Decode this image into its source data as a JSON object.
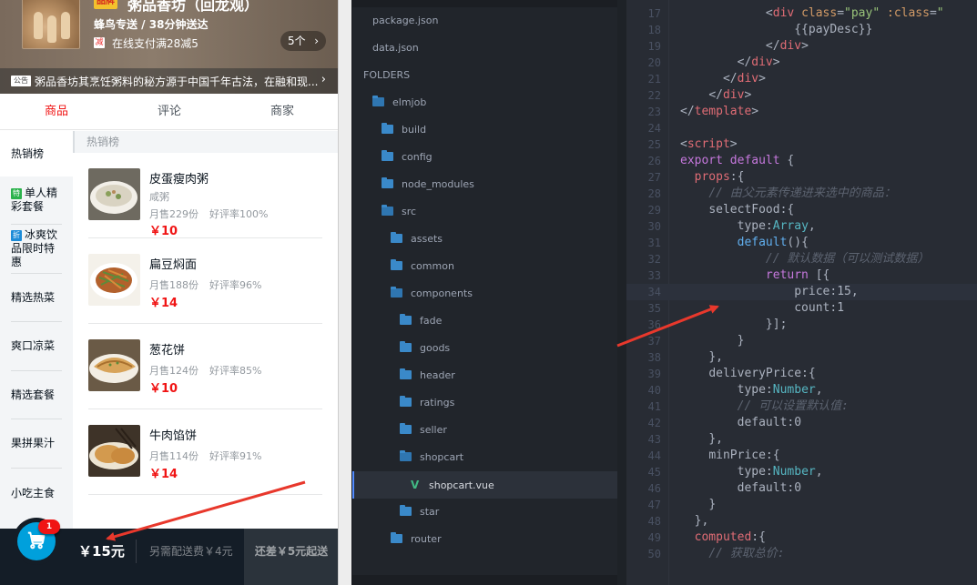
{
  "app": {
    "brand_badge": "品牌",
    "shop_name": "粥品香坊（回龙观）",
    "delivery": "蜂鸟专送 / 38分钟送达",
    "discount_icon": "减",
    "discount_text": "在线支付满28减5",
    "discount_count": "5个",
    "bulletin_badge": "公告",
    "bulletin_text": "粥品香坊其烹饪粥料的秘方源于中国千年古法，在融和现...",
    "tabs": [
      "商品",
      "评论",
      "商家"
    ],
    "menu": [
      {
        "label": "热销榜",
        "tag": ""
      },
      {
        "label": "单人精彩套餐",
        "tag": "特"
      },
      {
        "label": "冰爽饮品限时特惠",
        "tag": "折"
      },
      {
        "label": "精选热菜",
        "tag": ""
      },
      {
        "label": "爽口凉菜",
        "tag": ""
      },
      {
        "label": "精选套餐",
        "tag": ""
      },
      {
        "label": "果拼果汁",
        "tag": ""
      },
      {
        "label": "小吃主食",
        "tag": ""
      }
    ],
    "category_title": "热销榜",
    "foods": [
      {
        "name": "皮蛋瘦肉粥",
        "desc": "咸粥",
        "sell": "月售229份",
        "rating": "好评率100%",
        "price": "￥10"
      },
      {
        "name": "扁豆焖面",
        "desc": "",
        "sell": "月售188份",
        "rating": "好评率96%",
        "price": "￥14"
      },
      {
        "name": "葱花饼",
        "desc": "",
        "sell": "月售124份",
        "rating": "好评率85%",
        "price": "￥10"
      },
      {
        "name": "牛肉馅饼",
        "desc": "",
        "sell": "月售114份",
        "rating": "好评率91%",
        "price": "￥14"
      }
    ],
    "cart": {
      "badge": "1",
      "total": "￥15元",
      "fee": "另需配送费￥4元",
      "pay": "还差￥5元起送"
    }
  },
  "tree": {
    "rows": [
      {
        "label": "package.json",
        "icon": "none",
        "indent": 0
      },
      {
        "label": "data.json",
        "icon": "none",
        "indent": 0
      },
      {
        "label": "FOLDERS",
        "icon": "none",
        "indent": -1
      },
      {
        "label": "elmjob",
        "icon": "folder-open",
        "indent": 1
      },
      {
        "label": "build",
        "icon": "folder",
        "indent": 2
      },
      {
        "label": "config",
        "icon": "folder",
        "indent": 2
      },
      {
        "label": "node_modules",
        "icon": "folder",
        "indent": 2
      },
      {
        "label": "src",
        "icon": "folder-open",
        "indent": 2
      },
      {
        "label": "assets",
        "icon": "folder",
        "indent": 3
      },
      {
        "label": "common",
        "icon": "folder",
        "indent": 3
      },
      {
        "label": "components",
        "icon": "folder-open",
        "indent": 3
      },
      {
        "label": "fade",
        "icon": "folder",
        "indent": 4
      },
      {
        "label": "goods",
        "icon": "folder",
        "indent": 4
      },
      {
        "label": "header",
        "icon": "folder",
        "indent": 4
      },
      {
        "label": "ratings",
        "icon": "folder",
        "indent": 4
      },
      {
        "label": "seller",
        "icon": "folder",
        "indent": 4
      },
      {
        "label": "shopcart",
        "icon": "folder-open",
        "indent": 4
      },
      {
        "label": "shopcart.vue",
        "icon": "vue",
        "indent": 5
      },
      {
        "label": "star",
        "icon": "folder",
        "indent": 4
      },
      {
        "label": "router",
        "icon": "folder",
        "indent": 3
      }
    ]
  },
  "editor": {
    "lines": [
      {
        "n": "17",
        "html": "            <span class='p'>&lt;</span><span class='t'>div</span> <span class='a'>class</span><span class='p'>=</span><span class='s'>\"pay\"</span> <span class='a'>:class</span><span class='p'>=</span><span class='s'>\"</span>"
      },
      {
        "n": "18",
        "html": "                <span class='p'>{{payDesc}}</span>"
      },
      {
        "n": "19",
        "html": "            <span class='p'>&lt;/</span><span class='t'>div</span><span class='p'>&gt;</span>"
      },
      {
        "n": "20",
        "html": "        <span class='p'>&lt;/</span><span class='t'>div</span><span class='p'>&gt;</span>"
      },
      {
        "n": "21",
        "html": "      <span class='p'>&lt;/</span><span class='t'>div</span><span class='p'>&gt;</span>"
      },
      {
        "n": "22",
        "html": "    <span class='p'>&lt;/</span><span class='t'>div</span><span class='p'>&gt;</span>"
      },
      {
        "n": "23",
        "html": "<span class='p'>&lt;/</span><span class='t'>template</span><span class='p'>&gt;</span>"
      },
      {
        "n": "24",
        "html": ""
      },
      {
        "n": "25",
        "html": "<span class='p'>&lt;</span><span class='t'>script</span><span class='p'>&gt;</span>"
      },
      {
        "n": "26",
        "html": "<span class='k'>export</span> <span class='k'>default</span> <span class='p'>{</span>"
      },
      {
        "n": "27",
        "html": "  <span class='t'>props</span><span class='p'>:{</span>"
      },
      {
        "n": "28",
        "html": "    <span class='c'>// 由父元素传递进来选中的商品：</span>"
      },
      {
        "n": "29",
        "html": "    <span class='p'>selectFood:{</span>"
      },
      {
        "n": "30",
        "html": "        <span class='p'>type:</span><span class='ty'>Array</span><span class='p'>,</span>"
      },
      {
        "n": "31",
        "html": "        <span class='f'>default</span><span class='p'>(){</span>"
      },
      {
        "n": "32",
        "html": "            <span class='c'>// 默认数据（可以测试数据）</span>"
      },
      {
        "n": "33",
        "html": "            <span class='k'>return</span> <span class='p'>[{</span>"
      },
      {
        "n": "34",
        "html": "                <span class='p'>price:15,</span>",
        "cur": true
      },
      {
        "n": "35",
        "html": "                <span class='p'>count:1</span>"
      },
      {
        "n": "36",
        "html": "            <span class='p'>}];</span>"
      },
      {
        "n": "37",
        "html": "        <span class='p'>}</span>"
      },
      {
        "n": "38",
        "html": "    <span class='p'>},</span>"
      },
      {
        "n": "39",
        "html": "    <span class='p'>deliveryPrice:{</span>"
      },
      {
        "n": "40",
        "html": "        <span class='p'>type:</span><span class='ty'>Number</span><span class='p'>,</span>"
      },
      {
        "n": "41",
        "html": "        <span class='c'>// 可以设置默认值:</span>"
      },
      {
        "n": "42",
        "html": "        <span class='p'>default:0</span>"
      },
      {
        "n": "43",
        "html": "    <span class='p'>},</span>"
      },
      {
        "n": "44",
        "html": "    <span class='p'>minPrice:{</span>"
      },
      {
        "n": "45",
        "html": "        <span class='p'>type:</span><span class='ty'>Number</span><span class='p'>,</span>"
      },
      {
        "n": "46",
        "html": "        <span class='p'>default:0</span>"
      },
      {
        "n": "47",
        "html": "    <span class='p'>}</span>"
      },
      {
        "n": "48",
        "html": "  <span class='p'>},</span>"
      },
      {
        "n": "49",
        "html": "  <span class='t'>computed</span><span class='p'>:{</span>"
      },
      {
        "n": "50",
        "html": "    <span class='c'>// 获取总价:</span>"
      }
    ]
  },
  "colors": {
    "accent_red": "#f01414",
    "cart_blue": "#00a0dc",
    "arrow_red": "#e8382c",
    "editor_bg": "#282c34",
    "sidebar_bg": "#21252b"
  }
}
